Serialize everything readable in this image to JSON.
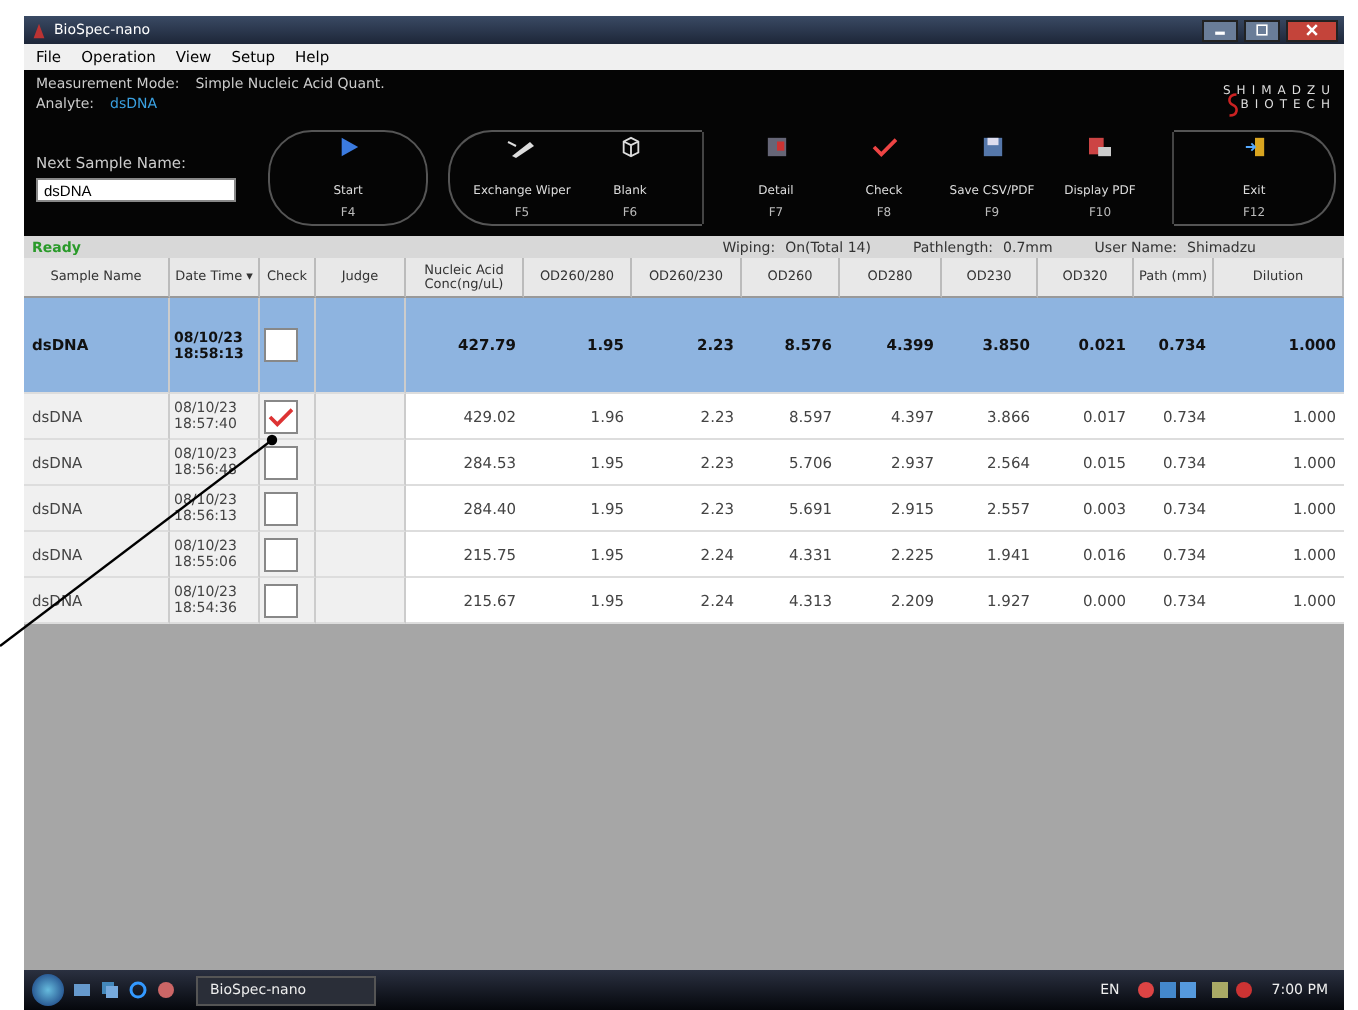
{
  "window": {
    "title": "BioSpec-nano"
  },
  "menu": [
    "File",
    "Operation",
    "View",
    "Setup",
    "Help"
  ],
  "mode": {
    "label": "Measurement Mode:",
    "value": "Simple Nucleic Acid Quant."
  },
  "analyte": {
    "label": "Analyte:",
    "value": "dsDNA"
  },
  "logo": {
    "top": "SHIMADZU",
    "bottom": "BIOTECH"
  },
  "next_sample": {
    "label": "Next Sample Name:",
    "value": "dsDNA"
  },
  "toolbar": [
    {
      "label": "Start",
      "key": "F4"
    },
    {
      "label": "Exchange Wiper",
      "key": "F5"
    },
    {
      "label": "Blank",
      "key": "F6"
    },
    {
      "label": "Detail",
      "key": "F7"
    },
    {
      "label": "Check",
      "key": "F8"
    },
    {
      "label": "Save CSV/PDF",
      "key": "F9"
    },
    {
      "label": "Display PDF",
      "key": "F10"
    },
    {
      "label": "Exit",
      "key": "F12"
    }
  ],
  "status": {
    "state": "Ready",
    "wiping_label": "Wiping:",
    "wiping": "On(Total 14)",
    "pathlength_label": "Pathlength:",
    "pathlength": "0.7mm",
    "user_label": "User Name:",
    "user": "Shimadzu"
  },
  "table": {
    "columns": [
      "Sample Name",
      "Date Time",
      "Check",
      "Judge",
      "Nucleic Acid Conc(ng/uL)",
      "OD260/280",
      "OD260/230",
      "OD260",
      "OD280",
      "OD230",
      "OD320",
      "Path (mm)",
      "Dilution"
    ],
    "sort_marker": "▾",
    "rows": [
      {
        "selected": true,
        "checked": false,
        "name": "dsDNA",
        "date": "08/10/23",
        "time": "18:58:13",
        "values": [
          "427.79",
          "1.95",
          "2.23",
          "8.576",
          "4.399",
          "3.850",
          "0.021",
          "0.734",
          "1.000"
        ]
      },
      {
        "selected": false,
        "checked": true,
        "name": "dsDNA",
        "date": "08/10/23",
        "time": "18:57:40",
        "values": [
          "429.02",
          "1.96",
          "2.23",
          "8.597",
          "4.397",
          "3.866",
          "0.017",
          "0.734",
          "1.000"
        ]
      },
      {
        "selected": false,
        "checked": false,
        "name": "dsDNA",
        "date": "08/10/23",
        "time": "18:56:48",
        "values": [
          "284.53",
          "1.95",
          "2.23",
          "5.706",
          "2.937",
          "2.564",
          "0.015",
          "0.734",
          "1.000"
        ]
      },
      {
        "selected": false,
        "checked": false,
        "name": "dsDNA",
        "date": "08/10/23",
        "time": "18:56:13",
        "values": [
          "284.40",
          "1.95",
          "2.23",
          "5.691",
          "2.915",
          "2.557",
          "0.003",
          "0.734",
          "1.000"
        ]
      },
      {
        "selected": false,
        "checked": false,
        "name": "dsDNA",
        "date": "08/10/23",
        "time": "18:55:06",
        "values": [
          "215.75",
          "1.95",
          "2.24",
          "4.331",
          "2.225",
          "1.941",
          "0.016",
          "0.734",
          "1.000"
        ]
      },
      {
        "selected": false,
        "checked": false,
        "name": "dsDNA",
        "date": "08/10/23",
        "time": "18:54:36",
        "values": [
          "215.67",
          "1.95",
          "2.24",
          "4.313",
          "2.209",
          "1.927",
          "0.000",
          "0.734",
          "1.000"
        ]
      }
    ]
  },
  "taskbar": {
    "task": "BioSpec-nano",
    "language": "EN",
    "clock": "7:00 PM"
  }
}
